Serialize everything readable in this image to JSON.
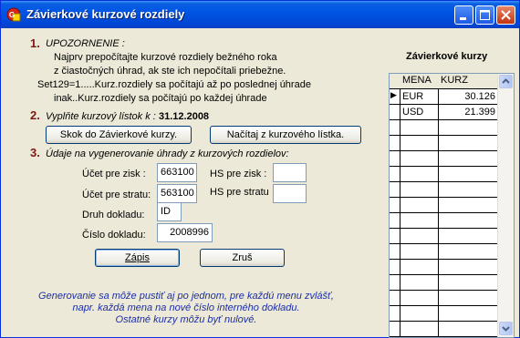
{
  "window": {
    "title": "Závierkové kurzové rozdiely"
  },
  "section1": {
    "number": "1.",
    "heading": "UPOZORNENIE :",
    "lines": [
      "Najprv prepočítajte kurzové rozdiely bežného roka",
      "z čiastočných úhrad, ak ste ich nepočítali priebežne.",
      "Set129=1.....Kurz.rozdiely sa počítajú až po poslednej úhrade",
      "inak..Kurz.rozdiely sa počítajú po každej úhrade"
    ]
  },
  "section2": {
    "number": "2.",
    "label": "Vyplňte kurzový lístok k :",
    "date": "31.12.2008",
    "skok_button": "Skok do Závierkové kurzy.",
    "nacitaj_button": "Načítaj z kurzového lístka."
  },
  "section3": {
    "number": "3.",
    "label": "Údaje na vygenerovanie úhrady z kurzových rozdielov:",
    "ucet_zisk_label": "Účet pre zisk :",
    "ucet_zisk_value": "663100",
    "ucet_strata_label": "Účet pre stratu:",
    "ucet_strata_value": "563100",
    "hs_zisk_label": "HS pre zisk :",
    "hs_zisk_value": "",
    "hs_strata_label": "HS pre stratu",
    "hs_strata_value": "",
    "druh_label": "Druh dokladu:",
    "druh_value": "ID",
    "cislo_label": "Číslo dokladu:",
    "cislo_value": "2008996"
  },
  "buttons": {
    "zapis": "Zápis",
    "zrus": "Zruš"
  },
  "note_lines": [
    "Generovanie sa môže pustiť aj po jednom, pre každú menu zvlášť,",
    "napr. každá mena na nové číslo interného dokladu.",
    "Ostatné kurzy môžu byť nulové."
  ],
  "grid": {
    "title": "Závierkové kurzy",
    "columns": [
      "MENA",
      "KURZ"
    ],
    "rows": [
      {
        "mena": "EUR",
        "kurz": "30.126"
      },
      {
        "mena": "USD",
        "kurz": "21.399"
      }
    ],
    "current_row_marker": "▶"
  },
  "colors": {
    "titlebar": "#0055e5",
    "number": "#7a1b12",
    "note": "#1c2ea8",
    "face": "#ece9d8"
  }
}
